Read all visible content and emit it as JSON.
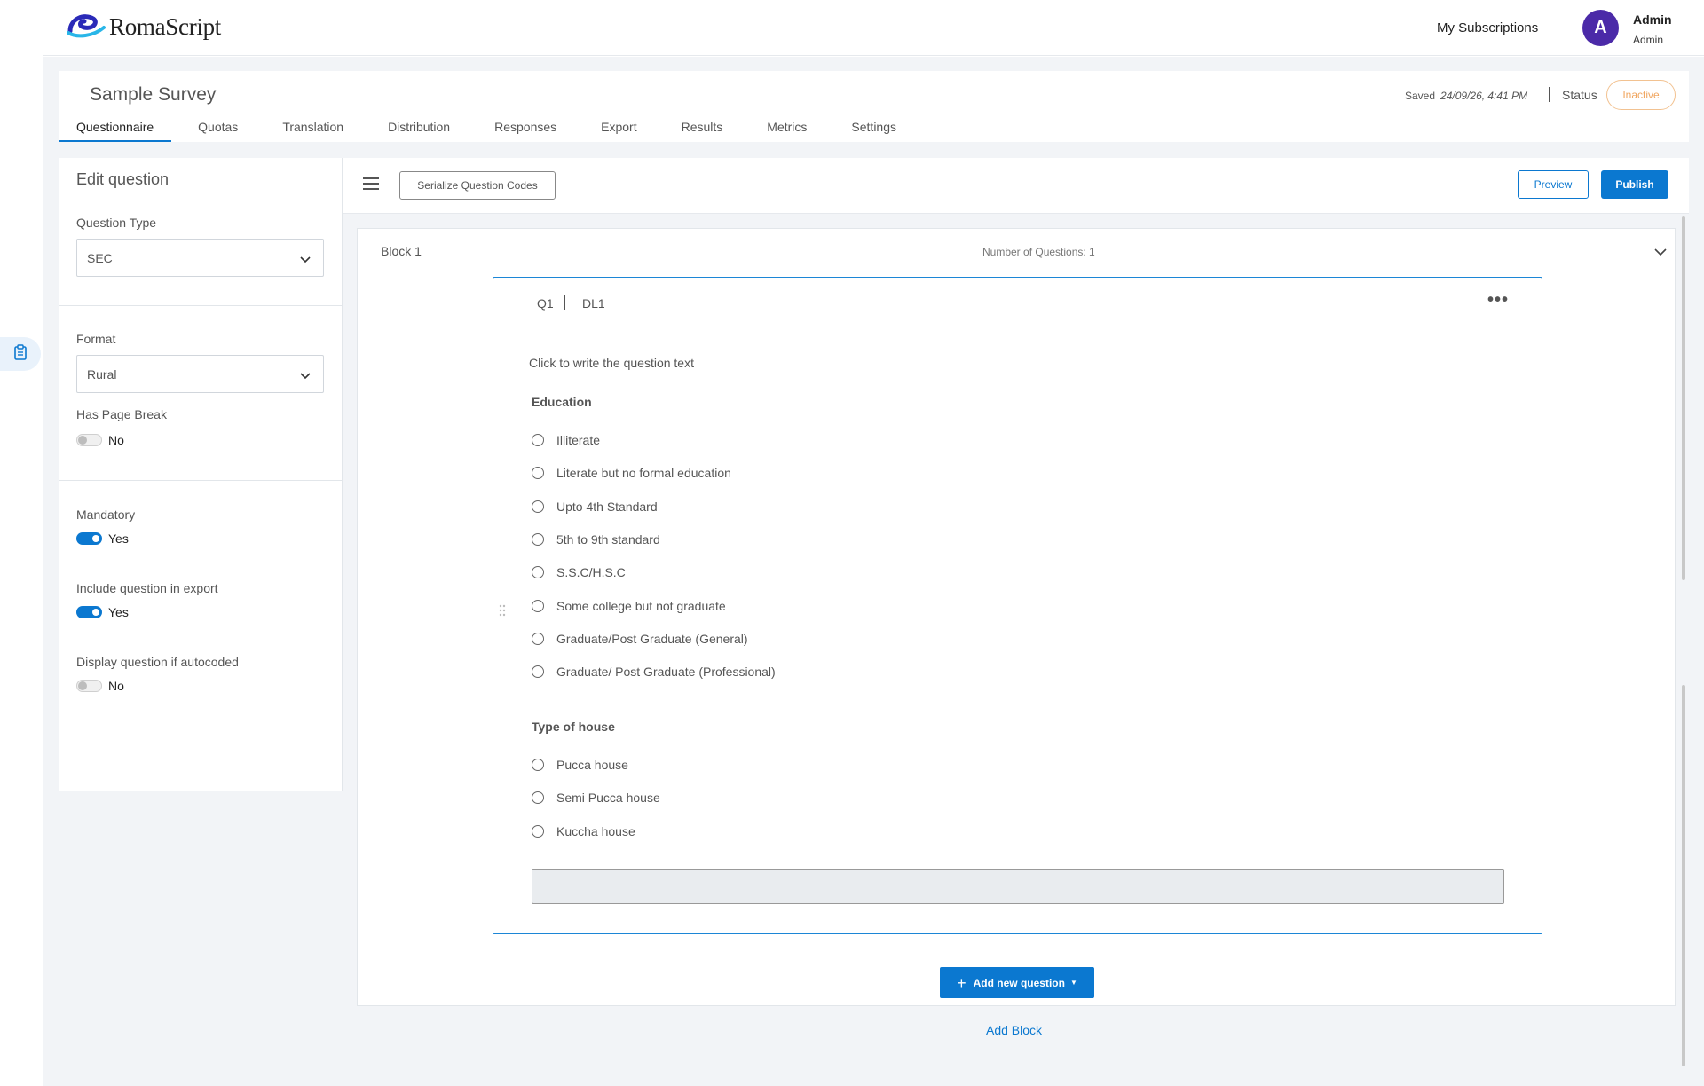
{
  "app": {
    "brand": "RomaScript",
    "nav": {
      "subscriptions_label": "My Subscriptions"
    },
    "user": {
      "initial": "A",
      "name": "Admin",
      "role": "Admin"
    }
  },
  "survey": {
    "title": "Sample Survey",
    "saved_label": "Saved",
    "saved_date": "24/09/26, 4:41 PM",
    "status_label": "Status",
    "status_value": "Inactive",
    "tabs": [
      {
        "label": "Questionnaire",
        "active": true
      },
      {
        "label": "Quotas"
      },
      {
        "label": "Translation"
      },
      {
        "label": "Distribution"
      },
      {
        "label": "Responses"
      },
      {
        "label": "Export"
      },
      {
        "label": "Results"
      },
      {
        "label": "Metrics"
      },
      {
        "label": "Settings"
      }
    ]
  },
  "edit_panel": {
    "title": "Edit question",
    "question_type": {
      "label": "Question Type",
      "value": "SEC"
    },
    "format": {
      "label": "Format",
      "value": "Rural"
    },
    "page_break": {
      "label": "Has Page Break",
      "value": "No",
      "on": false
    },
    "mandatory": {
      "label": "Mandatory",
      "value": "Yes",
      "on": true
    },
    "include_export": {
      "label": "Include question in export",
      "value": "Yes",
      "on": true
    },
    "display_autocoded": {
      "label": "Display question if autocoded",
      "value": "No",
      "on": false
    }
  },
  "toolbar": {
    "serialize_label": "Serialize Question Codes",
    "preview_label": "Preview",
    "publish_label": "Publish"
  },
  "block": {
    "title": "Block 1",
    "count_label": "Number of Questions: 1",
    "question": {
      "code": "Q1",
      "label": "DL1",
      "text": "Click to write the question text",
      "groups": [
        {
          "title": "Education",
          "options": [
            "Illiterate",
            "Literate but no formal education",
            "Upto 4th Standard",
            "5th to 9th standard",
            "S.S.C/H.S.C",
            "Some college but not graduate",
            "Graduate/Post Graduate (General)",
            "Graduate/ Post Graduate (Professional)"
          ]
        },
        {
          "title": "Type of house",
          "options": [
            "Pucca house",
            "Semi Pucca house",
            "Kuccha house"
          ]
        }
      ]
    },
    "add_question_label": "Add new question",
    "add_block_label": "Add Block"
  },
  "colors": {
    "accent": "#0b78d0",
    "avatar": "#4b2aa8",
    "inactive_status": "#f0a55e"
  }
}
